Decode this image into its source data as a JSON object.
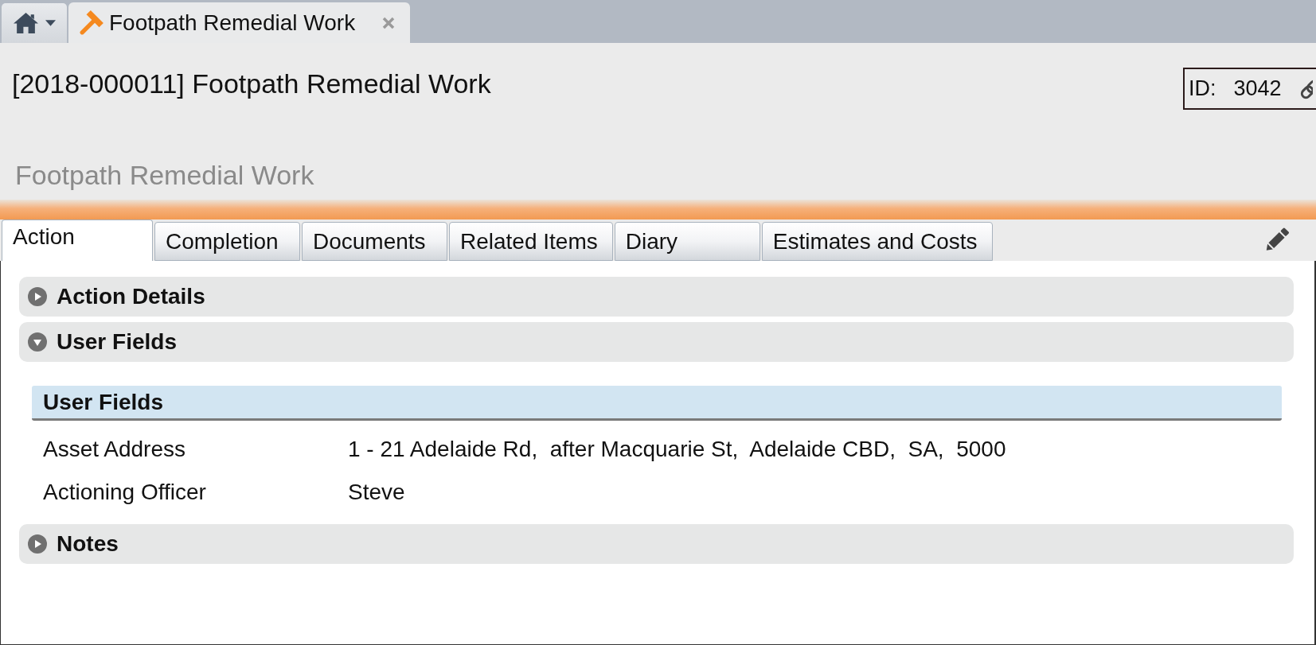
{
  "open_tabs": [
    {
      "label": "Footpath Remedial Work",
      "selected": true
    }
  ],
  "header": {
    "title": "[2018-000011] Footpath Remedial Work",
    "id_label": "ID:",
    "id_value": "3042",
    "subtitle": "Footpath Remedial Work"
  },
  "tabs": [
    {
      "label": "Action",
      "selected": true
    },
    {
      "label": "Completion",
      "selected": false
    },
    {
      "label": "Documents",
      "selected": false
    },
    {
      "label": "Related Items",
      "selected": false
    },
    {
      "label": "Diary",
      "selected": false
    },
    {
      "label": "Estimates and Costs",
      "selected": false
    }
  ],
  "sections": [
    {
      "title": "Action Details",
      "expanded": false
    },
    {
      "title": "User Fields",
      "expanded": true,
      "panel": {
        "title": "User Fields",
        "fields": [
          {
            "label": "Asset Address",
            "value": "1 - 21 Adelaide Rd,  after Macquarie St,  Adelaide CBD,  SA,  5000"
          },
          {
            "label": "Actioning Officer",
            "value": "Steve"
          }
        ]
      }
    },
    {
      "title": "Notes",
      "expanded": false
    }
  ]
}
